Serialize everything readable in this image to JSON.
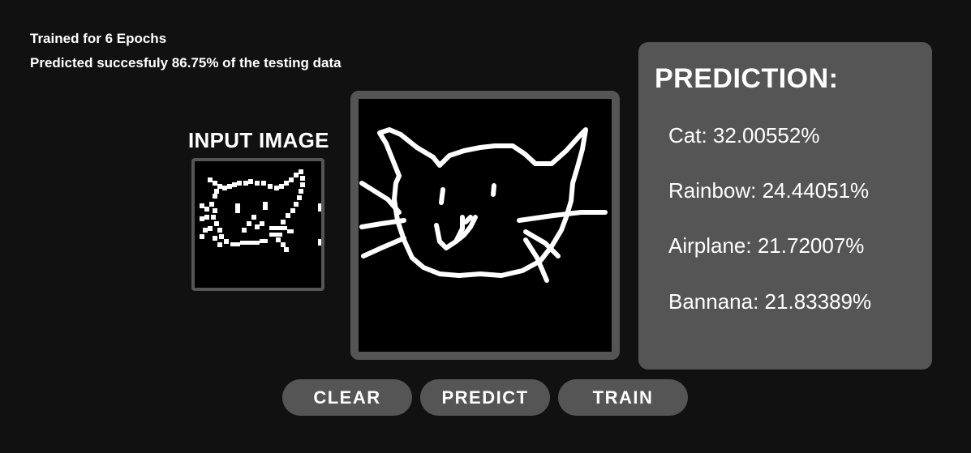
{
  "stats": {
    "trained": "Trained for 6 Epochs",
    "accuracy": "Predicted succesfuly 86.75% of the testing data"
  },
  "input": {
    "label": "INPUT IMAGE"
  },
  "prediction": {
    "title": "PREDICTION:",
    "items": [
      "Cat: 32.00552%",
      "Rainbow: 24.44051%",
      "Airplane: 21.72007%",
      "Bannana: 21.83389%"
    ]
  },
  "buttons": {
    "clear": "CLEAR",
    "predict": "PREDICT",
    "train": "TRAIN"
  },
  "colors": {
    "background": "#111111",
    "panel": "#555555",
    "canvas": "#000000",
    "stroke": "#ffffff"
  }
}
